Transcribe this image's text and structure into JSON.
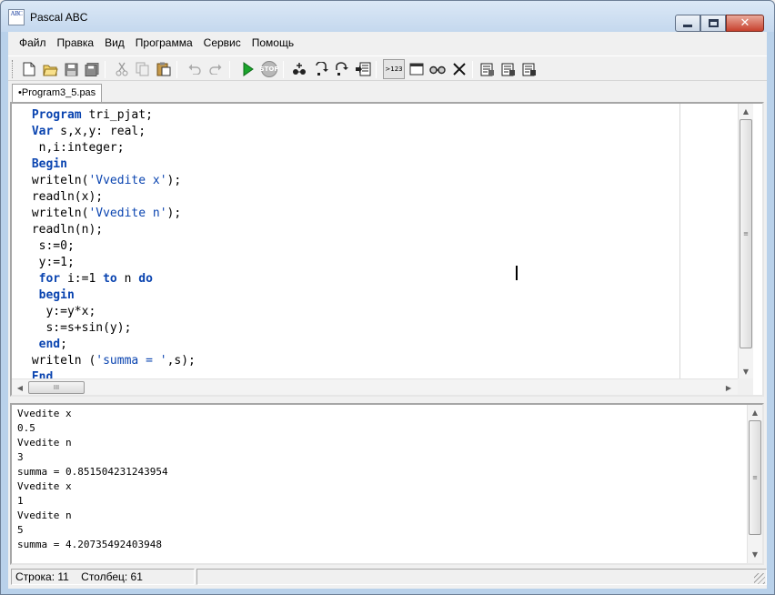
{
  "window": {
    "title": "Pascal ABC",
    "icon_text": "ABC",
    "controls": {
      "minimize_icon": "minimize-icon",
      "maximize_icon": "maximize-icon",
      "close_icon": "close-icon"
    }
  },
  "menu": {
    "items": [
      "Файл",
      "Правка",
      "Вид",
      "Программа",
      "Сервис",
      "Помощь"
    ]
  },
  "toolbar": {
    "buttons": [
      "new-file-icon",
      "open-folder-icon",
      "save-icon",
      "save-all-icon",
      "cut-icon",
      "copy-icon",
      "paste-icon",
      "undo-icon",
      "redo-icon",
      "run-icon",
      "stop-icon",
      "add-watch-icon",
      "step-into-icon",
      "step-over-icon",
      "run-to-cursor-icon",
      "output-123-icon",
      "window-icon",
      "glasses-icon",
      "delete-icon",
      "format-icon",
      "show-variables-icon",
      "show-results-icon"
    ],
    "output_label": ">123",
    "stop_label": "STOP"
  },
  "tab": {
    "label": "•Program3_5.pas"
  },
  "editor": {
    "lines": [
      [
        {
          "t": " "
        },
        {
          "t": "Program",
          "k": "kw"
        },
        {
          "t": " tri_pjat;"
        }
      ],
      [
        {
          "t": " "
        },
        {
          "t": "Var",
          "k": "kw"
        },
        {
          "t": " s,x,y: real;"
        }
      ],
      [
        {
          "t": "  n,i:integer;"
        }
      ],
      [
        {
          "t": " "
        },
        {
          "t": "Begin",
          "k": "kw"
        }
      ],
      [
        {
          "t": " writeln("
        },
        {
          "t": "'Vvedite x'",
          "k": "str"
        },
        {
          "t": ");"
        }
      ],
      [
        {
          "t": " readln(x);"
        }
      ],
      [
        {
          "t": " writeln("
        },
        {
          "t": "'Vvedite n'",
          "k": "str"
        },
        {
          "t": ");"
        }
      ],
      [
        {
          "t": " readln(n);"
        }
      ],
      [
        {
          "t": "  s:=0;"
        }
      ],
      [
        {
          "t": "  y:=1;"
        }
      ],
      [
        {
          "t": "  "
        },
        {
          "t": "for",
          "k": "kw"
        },
        {
          "t": " i:=1 "
        },
        {
          "t": "to",
          "k": "kw"
        },
        {
          "t": " n "
        },
        {
          "t": "do",
          "k": "kw"
        }
      ],
      [
        {
          "t": "  "
        },
        {
          "t": "begin",
          "k": "kw"
        }
      ],
      [
        {
          "t": "   y:=y*x;"
        }
      ],
      [
        {
          "t": "   s:=s+sin(y);"
        }
      ],
      [
        {
          "t": "  "
        },
        {
          "t": "end",
          "k": "kw"
        },
        {
          "t": ";"
        }
      ],
      [
        {
          "t": " writeln ("
        },
        {
          "t": "'summa = '",
          "k": "str"
        },
        {
          "t": ",s);"
        }
      ],
      [
        {
          "t": " "
        },
        {
          "t": "End",
          "k": "kw"
        },
        {
          "t": "."
        }
      ]
    ],
    "hscroll_thumb_grip": "III",
    "vscroll_thumb_grip": "≡"
  },
  "output": {
    "lines": [
      "Vvedite x",
      "0.5",
      "Vvedite n",
      "3",
      "summa = 0.851504231243954",
      "Vvedite x",
      "1",
      "Vvedite n",
      "5",
      "summa = 4.20735492403948"
    ]
  },
  "status": {
    "position": "Строка: 11    Столбец: 61",
    "info": ""
  },
  "colors": {
    "keyword": "#0a44b0",
    "window_frame": "#b9d1ea",
    "close_button": "#c7412d"
  }
}
